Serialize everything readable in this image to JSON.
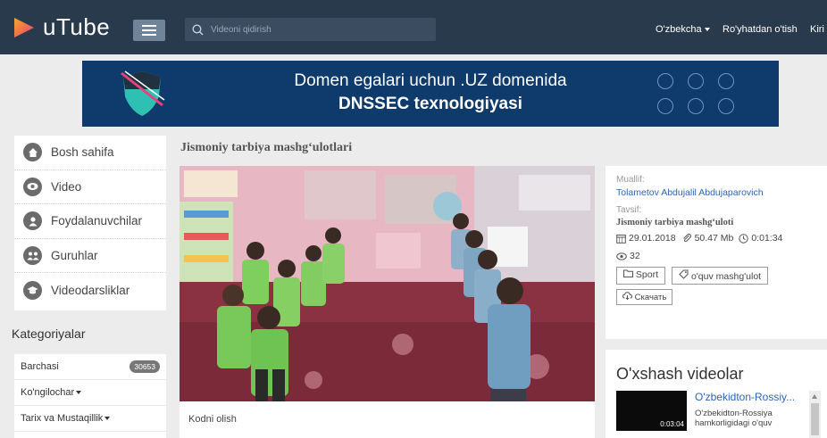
{
  "header": {
    "logo_text": "uTube",
    "search_placeholder": "Videoni qidirish",
    "language": "O'zbekcha",
    "register": "Ro'yhatdan o'tish",
    "login": "Kiri"
  },
  "banner": {
    "line1": "Domen egalari uchun .UZ domenida",
    "line2": "DNSSEC texnologiyasi"
  },
  "sidebar": {
    "items": [
      {
        "label": "Bosh sahifa",
        "icon": "home-icon"
      },
      {
        "label": "Video",
        "icon": "eye-icon"
      },
      {
        "label": "Foydalanuvchilar",
        "icon": "user-icon"
      },
      {
        "label": "Guruhlar",
        "icon": "group-icon"
      },
      {
        "label": "Videodarsliklar",
        "icon": "lesson-icon"
      }
    ]
  },
  "categories": {
    "title": "Kategoriyalar",
    "items": [
      {
        "label": "Barchasi",
        "count": "30653"
      },
      {
        "label": "Ko'ngilochar"
      },
      {
        "label": "Tarix va Mustaqillik"
      }
    ]
  },
  "main": {
    "title": "Jismoniy tarbiya mashg‘ulotlari",
    "embed_link": "Kodni olish"
  },
  "info": {
    "author_label": "Muallif:",
    "author": "Tolametov Abdujalil Abdujaparovich",
    "desc_label": "Tavsif:",
    "description": "Jismoniy tarbiya mashg‘uloti",
    "date": "29.01.2018",
    "size": "50.47 Mb",
    "duration": "0:01:34",
    "views": "32",
    "tags": [
      "Sport",
      "o'quv mashg'ulot"
    ],
    "download": "Скачать"
  },
  "similar": {
    "title": "O'xshash videolar",
    "items": [
      {
        "title": "O'zbekidton-Rossiy...",
        "description": "O'zbekidton-Rossiya hamkorligidagi o'quv",
        "time": "0:03:04"
      }
    ]
  },
  "colors": {
    "topbar": "#2a3a4d",
    "banner": "#0f3a6c",
    "link": "#2a66b8",
    "logo_accent": "#e8407a"
  }
}
